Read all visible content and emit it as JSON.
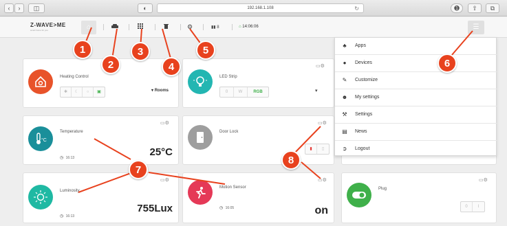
{
  "browser": {
    "url": "192.168.1.108",
    "back_icon": "chevron-left-icon",
    "forward_icon": "chevron-right-icon",
    "reload_icon": "reload-icon"
  },
  "header": {
    "logo": "Z-WAVE>ME",
    "logo_tagline": "smart home for you",
    "battery_count": "8",
    "clock": "14:06:06"
  },
  "widgets": {
    "heating": {
      "title": "Heating Control",
      "rooms_label": "Rooms",
      "icon_color": "#e8532a"
    },
    "led": {
      "title": "LED Strip",
      "buttons": [
        "0",
        "W",
        "RGB"
      ],
      "icon_color": "#23b6b2"
    },
    "temperature": {
      "title": "Temperature",
      "value": "25°C",
      "time": "16:13",
      "icon_color": "#1a8f9a"
    },
    "door": {
      "title": "Door Lock",
      "icon_color": "#9e9e9e"
    },
    "luminosity": {
      "title": "Luminosity",
      "value": "755Lux",
      "time": "16:13",
      "icon_color": "#1fb9a3"
    },
    "motion": {
      "title": "Motion Sensor",
      "value": "on",
      "time": "16:05",
      "icon_color": "#e53957"
    },
    "plug": {
      "title": "Plug",
      "buttons": [
        "0",
        "I"
      ],
      "icon_color": "#3fb04a"
    }
  },
  "menu": {
    "items": [
      {
        "label": "Apps",
        "icon": "apps-icon"
      },
      {
        "label": "Devices",
        "icon": "bulb-icon"
      },
      {
        "label": "Customize",
        "icon": "pencil-icon"
      },
      {
        "label": "My settings",
        "icon": "user-icon"
      },
      {
        "label": "Settings",
        "icon": "wrench-icon"
      },
      {
        "label": "News",
        "icon": "news-icon"
      },
      {
        "label": "Logout",
        "icon": "logout-icon"
      }
    ]
  },
  "callouts": [
    "1",
    "2",
    "3",
    "4",
    "5",
    "6",
    "7",
    "8"
  ],
  "colors": {
    "callout": "#e8421e",
    "accent_green": "#3fb04a"
  }
}
